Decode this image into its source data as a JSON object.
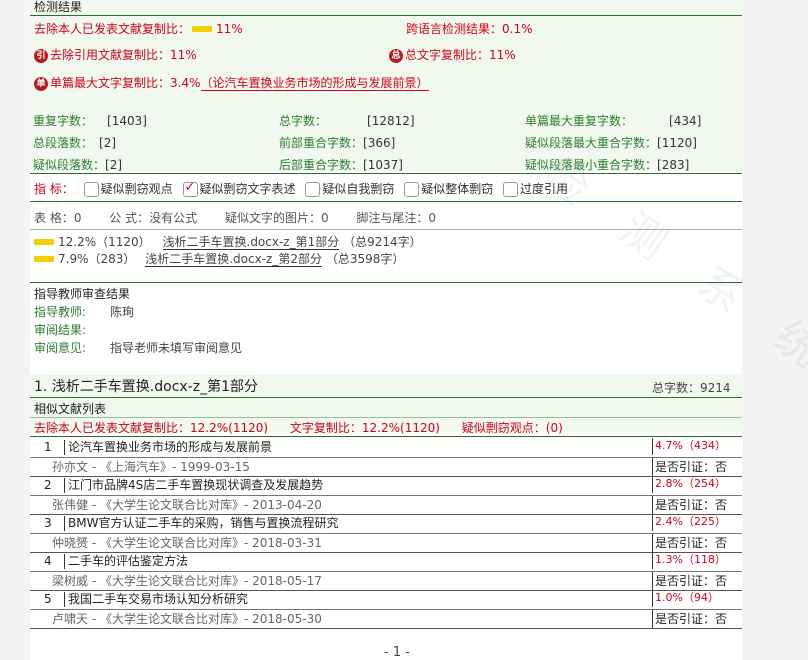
{
  "header": {
    "title": "检测结果"
  },
  "summary": {
    "exclude_self_label": "去除本人已发表文献复制比：",
    "exclude_self_value": "11%",
    "cross_lang_label": "跨语言检测结果：",
    "cross_lang_value": "0.1%",
    "exclude_cite_badge": "引",
    "exclude_cite_label": "去除引用文献复制比：",
    "exclude_cite_value": "11%",
    "total_copy_badge": "总",
    "total_copy_label": "总文字复制比：",
    "total_copy_value": "11%",
    "single_max_badge": "单",
    "single_max_label": "单篇最大文字复制比：",
    "single_max_value": "3.4%",
    "single_max_title": "（论汽车置换业务市场的形成与发展前景）"
  },
  "stats": {
    "dup_chars_label": "重复字数：",
    "dup_chars_value": "[1403]",
    "total_chars_label": "总字数：",
    "total_chars_value": "[12812]",
    "single_max_dup_label": "单篇最大重复字数：",
    "single_max_dup_value": "[434]",
    "total_para_label": "总段落数：",
    "total_para_value": "[2]",
    "front_overlap_label": "前部重合字数：",
    "front_overlap_value": "[366]",
    "sus_para_max_label": "疑似段落最大重合字数：",
    "sus_para_max_value": "[1120]",
    "sus_para_label": "疑似段落数：",
    "sus_para_value": "[2]",
    "back_overlap_label": "后部重合字数：",
    "back_overlap_value": "[1037]",
    "sus_para_min_label": "疑似段落最小重合字数：",
    "sus_para_min_value": "[283]"
  },
  "indicators": {
    "label": "指  标：",
    "items": [
      {
        "label": "疑似剽窃观点",
        "checked": false
      },
      {
        "label": "疑似剽窃文字表述",
        "checked": true
      },
      {
        "label": "疑似自我剽窃",
        "checked": false
      },
      {
        "label": "疑似整体剽窃",
        "checked": false
      },
      {
        "label": "过度引用",
        "checked": false
      }
    ]
  },
  "misc": {
    "tables": "表 格：0",
    "formulas": "公 式：没有公式",
    "images": "疑似文字的图片：0",
    "footnotes": "脚注与尾注：0"
  },
  "parts": [
    {
      "stat": "12.2%（1120）",
      "name": "浅析二手车置换.docx-z_第1部分",
      "count": "（总9214字）"
    },
    {
      "stat": "7.9%（283）",
      "name": "浅析二手车置换.docx-z_第2部分",
      "count": "（总3598字）"
    }
  ],
  "review": {
    "title": "指导教师审查结果",
    "teacher_label": "指导教师:",
    "teacher_value": "陈珣",
    "result_label": "审阅结果:",
    "result_value": "",
    "opinion_label": "审阅意见:",
    "opinion_value": "指导老师未填写审阅意见"
  },
  "section1": {
    "title": "1. 浅析二手车置换.docx-z_第1部分",
    "total_label": "总字数：9214",
    "sim_list_title": "相似文献列表",
    "exclude_self_label": "去除本人已发表文献复制比：",
    "exclude_self_value": "12.2%(1120)",
    "text_copy_label": "文字复制比：",
    "text_copy_value": "12.2%(1120)",
    "sus_view_label": "疑似剽窃观点：",
    "sus_view_value": "(0)"
  },
  "references": [
    {
      "num": "1",
      "title": "论汽车置换业务市场的形成与发展前景",
      "meta": "孙亦文 - 《上海汽车》- 1999-03-15",
      "pct": "4.7%（434）",
      "cite": "是否引证：否"
    },
    {
      "num": "2",
      "title": "江门市品牌4S店二手车置换现状调查及发展趋势",
      "meta": "张伟健 - 《大学生论文联合比对库》- 2013-04-20",
      "pct": "2.8%（254）",
      "cite": "是否引证：否"
    },
    {
      "num": "3",
      "title": "BMW官方认证二手车的采购，销售与置换流程研究",
      "meta": "仲晓赟 - 《大学生论文联合比对库》- 2018-03-31",
      "pct": "2.4%（225）",
      "cite": "是否引证：否"
    },
    {
      "num": "4",
      "title": "二手车的评估鉴定方法",
      "meta": "梁树威 - 《大学生论文联合比对库》- 2018-05-17",
      "pct": "1.3%（118）",
      "cite": "是否引证：否"
    },
    {
      "num": "5",
      "title": "我国二手车交易市场认知分析研究",
      "meta": "卢啸天 - 《大学生论文联合比对库》- 2018-05-30",
      "pct": "1.0%（94）",
      "cite": "是否引证：否"
    }
  ],
  "footer": {
    "page": "- 1 -"
  },
  "colors": {
    "accent_red": "#d0021b",
    "accent_green": "#2e7d32",
    "panel_green": "#f1f8ee",
    "bar_yellow": "#f0d000"
  }
}
